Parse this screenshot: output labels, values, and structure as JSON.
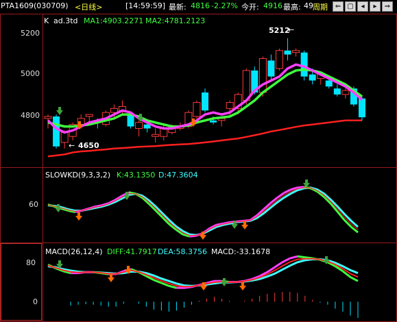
{
  "toolbar": {
    "symbol": "PTA1609(030709)",
    "period": "<日线>",
    "time": "[14:59:59]",
    "latest_label": "最新:",
    "latest_value": "4816",
    "change_pct": "-2.27%",
    "open_label": "今开:",
    "open_value": "4916",
    "high_label": "最高:",
    "high_value": "49",
    "cycle_label": "周期",
    "buttons": [
      "⇐",
      "▢",
      "◂",
      "▸",
      "⇒"
    ]
  },
  "colors": {
    "up": "#ff3b3b",
    "down": "#00e5ff",
    "ma1": "#ff40ff",
    "ma2": "#40ff40",
    "slow": "#ff2020",
    "grid": "#9b1b1b",
    "buy_arrow": "#ff6a00",
    "sell_arrow": "#3ea33e"
  },
  "price_panel": {
    "title": "K",
    "indicator": "ad.3td",
    "ma1_label": "MA1:4903.2271",
    "ma2_label": "MA2:4781.2123",
    "axis_ticks": [
      "5200",
      "5000",
      "4800"
    ],
    "high_marker": "5212",
    "low_marker": "4650"
  },
  "kd_panel": {
    "title": "SLOWKD(9,3,3,2)",
    "k_label": "K:43.1350",
    "d_label": "D:47.3604",
    "axis_ticks": [
      "60"
    ]
  },
  "macd_panel": {
    "title": "MACD(26,12,4)",
    "diff_label": "DIFF:41.7917",
    "dea_label": "DEA:58.3756",
    "macd_label": "MACD:-33.1678",
    "axis_ticks": [
      "80",
      "0"
    ]
  },
  "chart_data": [
    {
      "type": "candlestick",
      "title": "K",
      "ylim": [
        4580,
        5300
      ],
      "candles": [
        {
          "o": 4810,
          "h": 4830,
          "l": 4760,
          "c": 4820
        },
        {
          "o": 4820,
          "h": 4830,
          "l": 4660,
          "c": 4670
        },
        {
          "o": 4690,
          "h": 4750,
          "l": 4660,
          "c": 4740
        },
        {
          "o": 4720,
          "h": 4790,
          "l": 4700,
          "c": 4780
        },
        {
          "o": 4780,
          "h": 4830,
          "l": 4760,
          "c": 4810
        },
        {
          "o": 4820,
          "h": 4830,
          "l": 4780,
          "c": 4830
        },
        {
          "o": 4800,
          "h": 4810,
          "l": 4760,
          "c": 4790
        },
        {
          "o": 4780,
          "h": 4850,
          "l": 4770,
          "c": 4840
        },
        {
          "o": 4840,
          "h": 4880,
          "l": 4810,
          "c": 4860
        },
        {
          "o": 4850,
          "h": 4900,
          "l": 4830,
          "c": 4870
        },
        {
          "o": 4830,
          "h": 4840,
          "l": 4760,
          "c": 4770
        },
        {
          "o": 4760,
          "h": 4800,
          "l": 4720,
          "c": 4790
        },
        {
          "o": 4780,
          "h": 4800,
          "l": 4740,
          "c": 4760
        },
        {
          "o": 4720,
          "h": 4760,
          "l": 4690,
          "c": 4730
        },
        {
          "o": 4720,
          "h": 4780,
          "l": 4700,
          "c": 4760
        },
        {
          "o": 4740,
          "h": 4780,
          "l": 4730,
          "c": 4770
        },
        {
          "o": 4760,
          "h": 4790,
          "l": 4750,
          "c": 4770
        },
        {
          "o": 4770,
          "h": 4850,
          "l": 4760,
          "c": 4840
        },
        {
          "o": 4820,
          "h": 4900,
          "l": 4810,
          "c": 4890
        },
        {
          "o": 4940,
          "h": 4960,
          "l": 4840,
          "c": 4850
        },
        {
          "o": 4800,
          "h": 4820,
          "l": 4780,
          "c": 4790
        },
        {
          "o": 4800,
          "h": 4820,
          "l": 4770,
          "c": 4810
        },
        {
          "o": 4860,
          "h": 4900,
          "l": 4820,
          "c": 4890
        },
        {
          "o": 4860,
          "h": 4940,
          "l": 4830,
          "c": 4930
        },
        {
          "o": 4900,
          "h": 5060,
          "l": 4880,
          "c": 5050
        },
        {
          "o": 5050,
          "h": 5070,
          "l": 4930,
          "c": 4940
        },
        {
          "o": 4940,
          "h": 5120,
          "l": 4920,
          "c": 5110
        },
        {
          "o": 5100,
          "h": 5130,
          "l": 5000,
          "c": 5020
        },
        {
          "o": 5060,
          "h": 5160,
          "l": 5050,
          "c": 5150
        },
        {
          "o": 5150,
          "h": 5212,
          "l": 5100,
          "c": 5130
        },
        {
          "o": 5140,
          "h": 5160,
          "l": 5120,
          "c": 5150
        },
        {
          "o": 5140,
          "h": 5150,
          "l": 5000,
          "c": 5020
        },
        {
          "o": 5030,
          "h": 5060,
          "l": 4980,
          "c": 5000
        },
        {
          "o": 5010,
          "h": 5040,
          "l": 4980,
          "c": 5030
        },
        {
          "o": 5000,
          "h": 5010,
          "l": 4960,
          "c": 4970
        },
        {
          "o": 4960,
          "h": 4980,
          "l": 4920,
          "c": 4930
        },
        {
          "o": 4930,
          "h": 4960,
          "l": 4910,
          "c": 4950
        },
        {
          "o": 4960,
          "h": 4970,
          "l": 4870,
          "c": 4880
        },
        {
          "o": 4910,
          "h": 4920,
          "l": 4800,
          "c": 4816
        }
      ],
      "ma1": [
        4800,
        4760,
        4740,
        4750,
        4770,
        4790,
        4800,
        4810,
        4830,
        4850,
        4840,
        4810,
        4790,
        4770,
        4760,
        4760,
        4770,
        4780,
        4800,
        4830,
        4840,
        4830,
        4840,
        4870,
        4900,
        4950,
        4980,
        5000,
        5020,
        5060,
        5080,
        5070,
        5050,
        5030,
        5010,
        4990,
        4970,
        4940,
        4903
      ],
      "ma2": [
        4790,
        4780,
        4770,
        4770,
        4775,
        4780,
        4790,
        4800,
        4810,
        4830,
        4830,
        4820,
        4800,
        4790,
        4780,
        4770,
        4770,
        4775,
        4790,
        4800,
        4810,
        4815,
        4820,
        4840,
        4870,
        4900,
        4940,
        4970,
        5000,
        5030,
        5050,
        5055,
        5050,
        5040,
        5020,
        5000,
        4980,
        4950,
        4920
      ],
      "slow": [
        4620,
        4625,
        4630,
        4640,
        4645,
        4648,
        4652,
        4655,
        4660,
        4662,
        4665,
        4668,
        4670,
        4672,
        4675,
        4678,
        4680,
        4682,
        4686,
        4690,
        4695,
        4700,
        4705,
        4710,
        4718,
        4726,
        4735,
        4745,
        4752,
        4760,
        4768,
        4775,
        4780,
        4785,
        4790,
        4795,
        4800,
        4800,
        4800
      ]
    },
    {
      "type": "line",
      "title": "SLOWKD(9,3,3,2)",
      "ylim": [
        5,
        100
      ],
      "series": [
        {
          "name": "K",
          "values": [
            61,
            58,
            55,
            52,
            50,
            52,
            55,
            58,
            60,
            63,
            68,
            74,
            79,
            77,
            71,
            62,
            52,
            42,
            32,
            24,
            17,
            14,
            15,
            19,
            26,
            31,
            33,
            35,
            36,
            37,
            38,
            45,
            54,
            63,
            71,
            78,
            83,
            86,
            87,
            85,
            80,
            72,
            62,
            50,
            38,
            28,
            20
          ]
        },
        {
          "name": "D",
          "values": [
            60,
            59,
            57,
            54,
            52,
            52,
            54,
            56,
            58,
            61,
            65,
            70,
            75,
            77,
            74,
            67,
            58,
            48,
            38,
            29,
            22,
            17,
            16,
            18,
            23,
            28,
            31,
            33,
            35,
            36,
            37,
            41,
            48,
            56,
            64,
            71,
            77,
            82,
            85,
            86,
            83,
            77,
            68,
            58,
            47,
            37,
            28
          ]
        }
      ]
    },
    {
      "type": "bar",
      "title": "MACD(26,12,4)",
      "ylim": [
        -30,
        95
      ],
      "series": [
        {
          "name": "DIFF",
          "values": [
            75,
            68,
            62,
            58,
            58,
            60,
            60,
            58,
            56,
            56,
            62,
            66,
            60,
            52,
            44,
            38,
            32,
            28,
            28,
            30,
            34,
            38,
            42,
            42,
            40,
            40,
            42,
            46,
            52,
            60,
            70,
            80,
            88,
            92,
            90,
            88,
            85,
            80,
            72,
            62,
            50,
            42
          ]
        },
        {
          "name": "DEA",
          "values": [
            72,
            70,
            66,
            63,
            61,
            60,
            60,
            59,
            58,
            57,
            58,
            61,
            61,
            58,
            53,
            47,
            42,
            37,
            33,
            32,
            33,
            35,
            37,
            39,
            39,
            40,
            41,
            43,
            46,
            51,
            57,
            65,
            73,
            80,
            84,
            86,
            86,
            84,
            79,
            72,
            64,
            58
          ]
        },
        {
          "name": "MACD",
          "values": [
            0,
            0,
            0,
            -8,
            -6,
            -5,
            -6,
            -8,
            -10,
            -10,
            -4,
            0,
            -4,
            -10,
            -16,
            -18,
            -20,
            -18,
            -12,
            -6,
            2,
            6,
            10,
            6,
            2,
            0,
            2,
            6,
            12,
            16,
            18,
            20,
            20,
            18,
            12,
            4,
            -2,
            -6,
            -14,
            -20,
            -28,
            -33
          ]
        }
      ]
    }
  ]
}
